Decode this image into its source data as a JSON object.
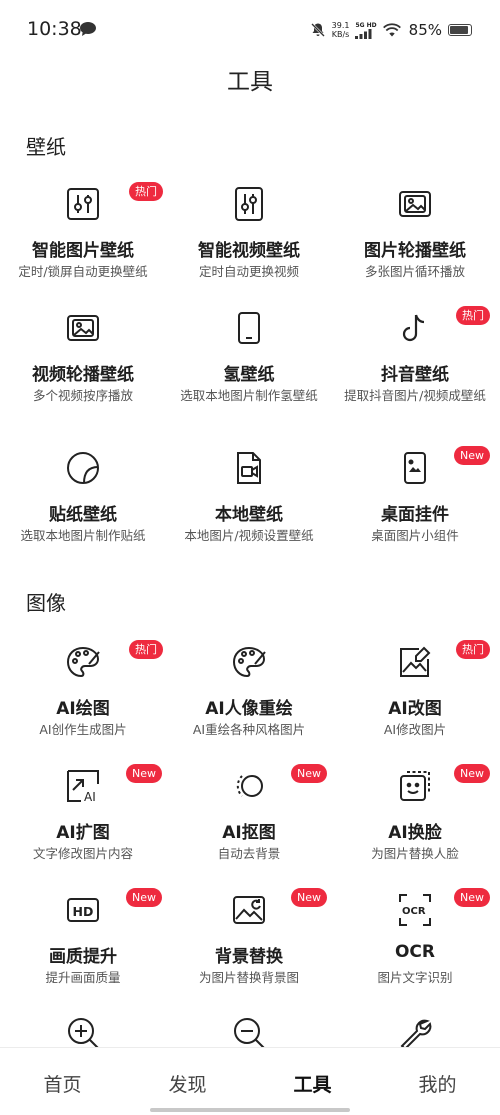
{
  "status": {
    "time": "10:38",
    "speed_value": "39.1",
    "speed_unit": "KB/s",
    "network": "5G HD",
    "battery": "85%"
  },
  "header": {
    "title": "工具"
  },
  "sections": [
    {
      "title": "壁纸",
      "items": [
        {
          "label": "智能图片壁纸",
          "desc": "定时/锁屏自动更换壁纸",
          "icon": "sliders-icon",
          "badge": "热门"
        },
        {
          "label": "智能视频壁纸",
          "desc": "定时自动更换视频",
          "icon": "sliders-icon",
          "badge": ""
        },
        {
          "label": "图片轮播壁纸",
          "desc": "多张图片循环播放",
          "icon": "image-stack-icon",
          "badge": ""
        },
        {
          "label": "视频轮播壁纸",
          "desc": "多个视频按序播放",
          "icon": "image-stack-icon",
          "badge": ""
        },
        {
          "label": "氢壁纸",
          "desc": "选取本地图片制作氢壁纸",
          "icon": "phone-icon",
          "badge": ""
        },
        {
          "label": "抖音壁纸",
          "desc": "提取抖音图片/视频成壁纸",
          "icon": "tiktok-icon",
          "badge": "热门"
        },
        {
          "label": "贴纸壁纸",
          "desc": "选取本地图片制作贴纸",
          "icon": "sticker-icon",
          "badge": ""
        },
        {
          "label": "本地壁纸",
          "desc": "本地图片/视频设置壁纸",
          "icon": "video-file-icon",
          "badge": ""
        },
        {
          "label": "桌面挂件",
          "desc": "桌面图片小组件",
          "icon": "phone-widget-icon",
          "badge": "New"
        }
      ]
    },
    {
      "title": "图像",
      "items": [
        {
          "label": "AI绘图",
          "desc": "AI创作生成图片",
          "icon": "palette-icon",
          "badge": "热门"
        },
        {
          "label": "AI人像重绘",
          "desc": "AI重绘各种风格图片",
          "icon": "palette-icon",
          "badge": ""
        },
        {
          "label": "AI改图",
          "desc": "AI修改图片",
          "icon": "image-edit-icon",
          "badge": "热门"
        },
        {
          "label": "AI扩图",
          "desc": "文字修改图片内容",
          "icon": "ai-expand-icon",
          "badge": "New"
        },
        {
          "label": "AI抠图",
          "desc": "自动去背景",
          "icon": "cutout-icon",
          "badge": "New"
        },
        {
          "label": "AI换脸",
          "desc": "为图片替换人脸",
          "icon": "face-swap-icon",
          "badge": "New"
        },
        {
          "label": "画质提升",
          "desc": "提升画面质量",
          "icon": "hd-icon",
          "badge": "New"
        },
        {
          "label": "背景替换",
          "desc": "为图片替换背景图",
          "icon": "background-replace-icon",
          "badge": "New"
        },
        {
          "label": "OCR",
          "desc": "图片文字识别",
          "icon": "ocr-icon",
          "badge": "New"
        },
        {
          "label": "",
          "desc": "",
          "icon": "zoom-in-icon",
          "badge": ""
        },
        {
          "label": "",
          "desc": "",
          "icon": "zoom-out-icon",
          "badge": ""
        },
        {
          "label": "",
          "desc": "",
          "icon": "wrench-icon",
          "badge": ""
        }
      ]
    }
  ],
  "tabbar": [
    {
      "label": "首页",
      "active": false
    },
    {
      "label": "发现",
      "active": false
    },
    {
      "label": "工具",
      "active": true
    },
    {
      "label": "我的",
      "active": false
    }
  ],
  "colors": {
    "badge": "#ee2a3f",
    "text": "#222222",
    "muted": "#555555"
  }
}
